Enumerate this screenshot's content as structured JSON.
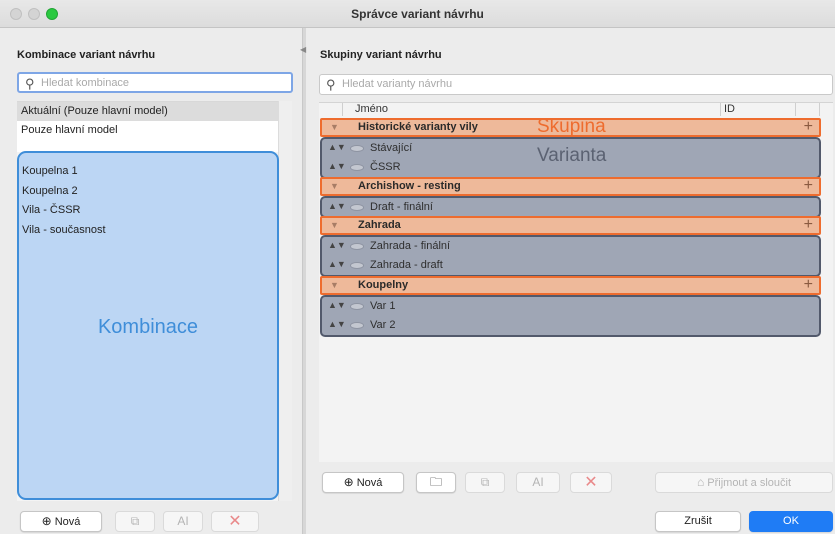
{
  "window": {
    "title": "Správce variant návrhu"
  },
  "left": {
    "title": "Kombinace variant návrhu",
    "search_placeholder": "Hledat kombinace",
    "rows": [
      "Aktuální (Pouze hlavní model)",
      "Pouze hlavní model"
    ],
    "combos": [
      "Koupelna 1",
      "Koupelna 2",
      "Vila - ČSSR",
      "Vila - současnost"
    ],
    "overlay_label": "Kombinace",
    "buttons": {
      "new": "Nová",
      "new_icon": "⊕",
      "duplicate_icon": "⧉",
      "rename_icon": "AI",
      "delete_icon": "✕"
    }
  },
  "right": {
    "title": "Skupiny variant návrhu",
    "search_placeholder": "Hledat varianty návrhu",
    "columns": {
      "name": "Jméno",
      "id": "ID"
    },
    "groups": [
      {
        "name": "Historické varianty vily",
        "variants": [
          "Stávající",
          "ČSSR"
        ]
      },
      {
        "name": "Archishow - resting",
        "variants": [
          "Draft - finální"
        ]
      },
      {
        "name": "Zahrada",
        "variants": [
          "Zahrada - finální",
          "Zahrada - draft"
        ]
      },
      {
        "name": "Koupelny",
        "variants": [
          "Var 1",
          "Var 2"
        ]
      }
    ],
    "overlay_group_label": "Skupina",
    "overlay_variant_label": "Varianta",
    "buttons": {
      "new": "Nová",
      "new_icon": "⊕",
      "accept_merge": "Přijmout a sloučit"
    }
  },
  "footer": {
    "cancel": "Zrušit",
    "ok": "OK"
  },
  "colors": {
    "group_fill": "#eeb99a",
    "group_border": "#ee6c2e",
    "variant_fill": "#9fa6b5",
    "variant_border": "#52596b",
    "combo_fill": "#bcd6f4",
    "combo_border": "#3f8ed9",
    "accent": "#1f7cf5"
  }
}
